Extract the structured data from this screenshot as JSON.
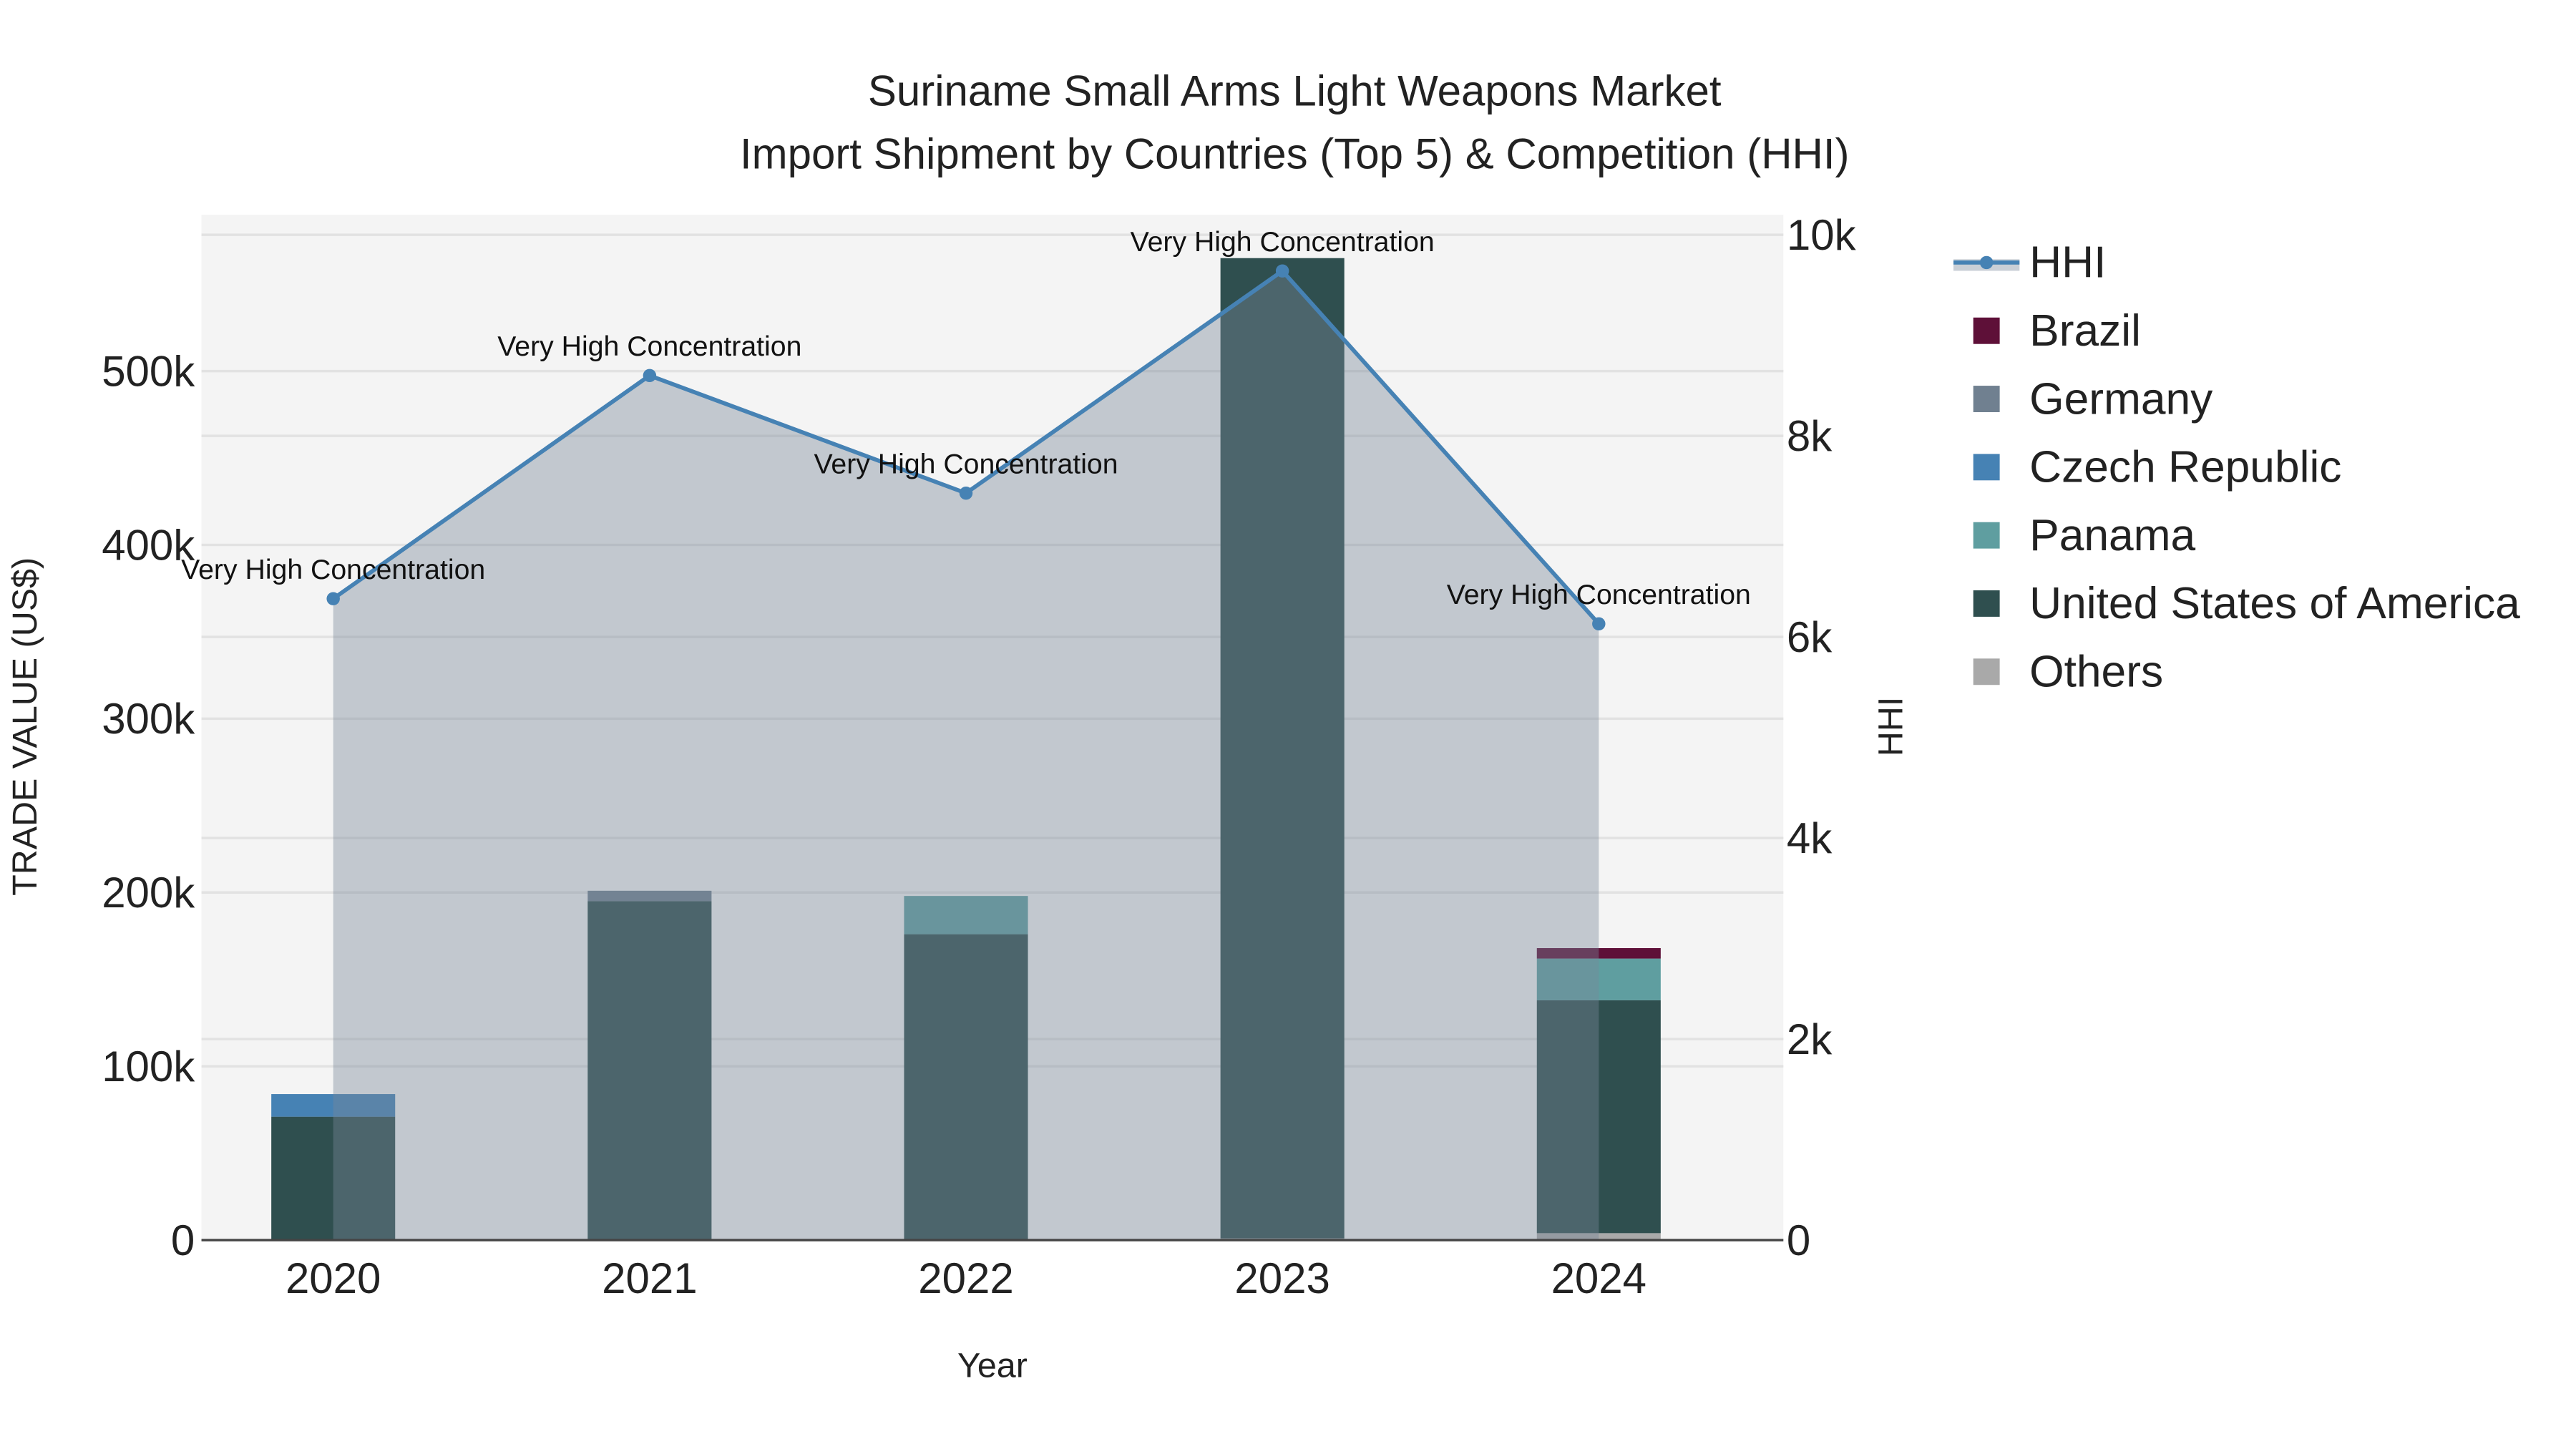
{
  "chart_data": {
    "type": "bar",
    "title_line1": "Suriname Small Arms Light Weapons Market",
    "title_line2": "Import Shipment by Countries (Top 5) & Competition (HHI)",
    "xlabel": "Year",
    "ylabel": "TRADE VALUE (US$)",
    "y2label": "HHI",
    "categories": [
      "2020",
      "2021",
      "2022",
      "2023",
      "2024"
    ],
    "ylim": [
      0,
      590000
    ],
    "y2lim": [
      0,
      10200
    ],
    "yticks": [
      0,
      100000,
      200000,
      300000,
      400000,
      500000
    ],
    "ytick_labels": [
      "0",
      "100k",
      "200k",
      "300k",
      "400k",
      "500k"
    ],
    "y2ticks": [
      0,
      2000,
      4000,
      6000,
      8000,
      10000
    ],
    "y2tick_labels": [
      "0",
      "2k",
      "4k",
      "6k",
      "8k",
      "10k"
    ],
    "series": [
      {
        "name": "Others",
        "color": "#A9A9A9",
        "values": [
          0,
          0,
          0,
          1000,
          4000
        ]
      },
      {
        "name": "United States of America",
        "color": "#2F4F4F",
        "values": [
          71000,
          195000,
          176000,
          564000,
          134000
        ]
      },
      {
        "name": "Panama",
        "color": "#5F9EA0",
        "values": [
          0,
          0,
          22000,
          0,
          24000
        ]
      },
      {
        "name": "Czech Republic",
        "color": "#4682B4",
        "values": [
          13000,
          0,
          0,
          0,
          0
        ]
      },
      {
        "name": "Germany",
        "color": "#708090",
        "values": [
          0,
          6000,
          0,
          0,
          0
        ]
      },
      {
        "name": "Brazil",
        "color": "#5E1038",
        "values": [
          0,
          0,
          0,
          0,
          6000
        ]
      }
    ],
    "hhi": {
      "name": "HHI",
      "color": "#4682B4",
      "values": [
        6380,
        8600,
        7430,
        9640,
        6130
      ],
      "labels": [
        "Very High Concentration",
        "Very High Concentration",
        "Very High Concentration",
        "Very High Concentration",
        "Very High Concentration"
      ]
    },
    "legend": {
      "placement": "right",
      "entries": [
        "HHI",
        "Brazil",
        "Germany",
        "Czech Republic",
        "Panama",
        "United States of America",
        "Others"
      ]
    },
    "grid": true
  }
}
